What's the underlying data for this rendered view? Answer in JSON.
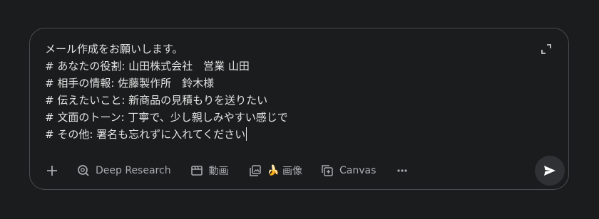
{
  "prompt": {
    "lines": [
      "メール作成をお願いします。",
      "# あなたの役割: 山田株式会社　営業 山田",
      "# 相手の情報: 佐藤製作所　鈴木様",
      "# 伝えたいこと: 新商品の見積もりを送りたい",
      "# 文面のトーン: 丁寧で、少し親しみやすい感じで",
      "# その他: 署名も忘れずに入れてください"
    ]
  },
  "toolbar": {
    "add_icon": "plus-icon",
    "deep_research_label": "Deep Research",
    "deep_research_icon": "deep-research-icon",
    "video_label": "動画",
    "video_icon": "film-icon",
    "image_label": "画像",
    "image_icon": "image-gallery-icon",
    "image_badge": "🍌",
    "canvas_label": "Canvas",
    "canvas_icon": "canvas-icon",
    "more_icon": "more-horizontal-icon"
  },
  "actions": {
    "expand_icon": "expand-icon",
    "send_icon": "send-icon"
  },
  "colors": {
    "background": "#1b1c1d",
    "border": "#4a4c50",
    "text": "#e3e3e3",
    "muted": "#a8abaf",
    "send_bg": "#2f3134"
  }
}
